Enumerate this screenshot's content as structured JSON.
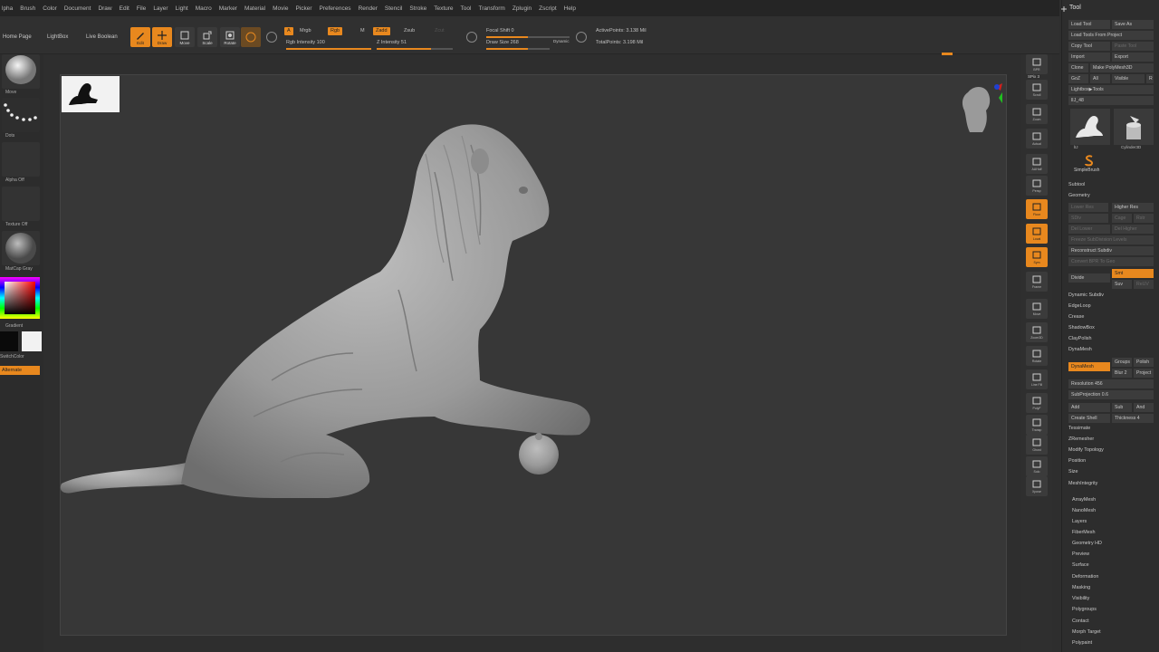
{
  "menubar": {
    "items": [
      "lpha",
      "Brush",
      "Color",
      "Document",
      "Draw",
      "Edit",
      "File",
      "Layer",
      "Light",
      "Macro",
      "Marker",
      "Material",
      "Movie",
      "Picker",
      "Preferences",
      "Render",
      "Stencil",
      "Stroke",
      "Texture",
      "Tool",
      "Transform",
      "Zplugin",
      "Zscript",
      "Help"
    ]
  },
  "shelf": {
    "home_page": "Home Page",
    "lightbox": "LightBox",
    "live_boolean": "Live Boolean",
    "edit": "Edit",
    "draw": "Draw",
    "move": "Move",
    "scale": "Scale",
    "rotate": "Rotate",
    "a_tag": "A",
    "mrgb": "Mrgb",
    "rgb_tag": "Rgb",
    "m_tag": "M",
    "zadd_tag": "Zadd",
    "zsub": "Zsub",
    "zcut": "Zcut",
    "rgb_intensity": "Rgb Intensity 100",
    "z_intensity": "Z Intensity 51",
    "focal_shift": "Focal Shift 0",
    "draw_size": "Draw Size 268",
    "dynamic": "Dynamic",
    "active_points": "ActivePoints: 3.138 Mil",
    "total_points": "TotalPoints: 3.198 Mil"
  },
  "left_tray": {
    "brush": "Move",
    "stroke": "Dots",
    "alpha": "Alpha Off",
    "texture": "Texture Off",
    "material": "MatCap Gray",
    "gradient": "Gradient",
    "switch_color": "SwitchColor",
    "alternate": "Alternate"
  },
  "right_tray": {
    "spix": "SPix 3",
    "items": [
      "BPR",
      "Scroll",
      "Zoom",
      "Actual",
      "AAHalf",
      "Persp",
      "Floor",
      "Local",
      "Sym",
      "Frame",
      "Move",
      "Zoom3D",
      "Rotate",
      "Line Fill",
      "PolyF",
      "Transp",
      "Ghost",
      "Solo",
      "Xpose"
    ]
  },
  "palette": {
    "title": "Tool",
    "load_tool": "Load Tool",
    "save_as": "Save As",
    "load_tools_from_project": "Load Tools From Project",
    "copy_tool": "Copy Tool",
    "paste_tool": "Paste Tool",
    "import": "Import",
    "export": "Export",
    "clone": "Clone",
    "make_polymesh": "Make PolyMesh3D",
    "goz": "GoZ",
    "all": "All",
    "visible": "Visible",
    "r": "R",
    "lightbox_tools": "Lightbox▶Tools",
    "lion_count": "lIJ_48",
    "tool_a": "lIJ",
    "tool_b": "Cylinder3D",
    "simple_brush": "SimpleBrush",
    "subtool": "Subtool",
    "geometry": "Geometry",
    "lower_res": "Lower Res",
    "higher_res": "Higher Res",
    "sdiv": "SDiv",
    "cage": "Cage",
    "rstr": "Rstr",
    "del_lower": "Del Lower",
    "del_higher": "Del Higher",
    "freeze_subdivision_levels": "Freeze SubDivision Levels",
    "reconstruct_subdiv": "Reconstruct Subdiv",
    "convert_bpr_to_geo": "Convert BPR To Geo",
    "divide": "Divide",
    "smt": "Smt",
    "suv": "Suv",
    "reuv": "ReUV",
    "dynamic_subdiv": "Dynamic Subdiv",
    "edgeloop": "EdgeLoop",
    "crease": "Crease",
    "shadowbox": "ShadowBox",
    "claypolish": "ClayPolish",
    "dynamesh_section": "DynaMesh",
    "dynamesh_btn": "DynaMesh",
    "groups": "Groups",
    "polish": "Polish",
    "blur": "Blur 2",
    "project": "Project",
    "resolution": "Resolution 456",
    "subprojection": "SubProjection 0.6",
    "add": "Add",
    "sub": "Sub",
    "and": "And",
    "create_shell": "Create Shell",
    "thickness": "Thickness 4",
    "tessimate": "Tessimate",
    "zremesher": "ZRemesher",
    "modify_topology": "Modify Topology",
    "position": "Position",
    "size": "Size",
    "mesh_integrity": "MeshIntegrity",
    "sections": [
      "ArrayMesh",
      "NanoMesh",
      "Layers",
      "FiberMesh",
      "Geometry HD",
      "Preview",
      "Surface",
      "Deformation",
      "Masking",
      "Visibility",
      "Polygroups",
      "Contact",
      "Morph Target",
      "Polypaint"
    ]
  },
  "colors": {
    "accent": "#e8881e",
    "panel": "#2d2d2d",
    "viewport": "#373737",
    "menubar": "#252525"
  }
}
